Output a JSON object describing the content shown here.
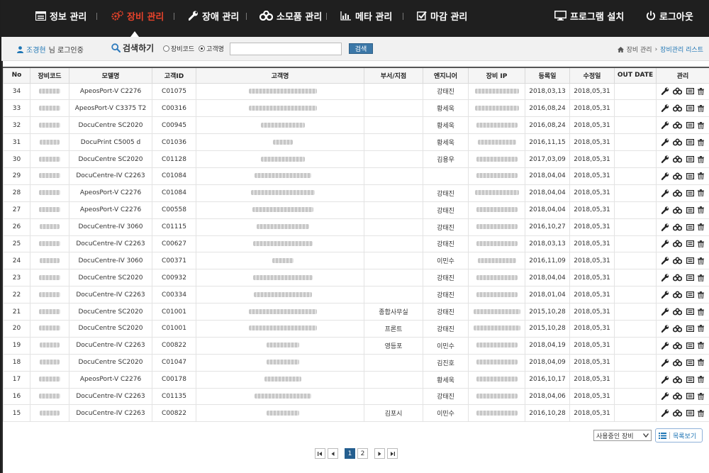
{
  "nav": {
    "items": [
      {
        "label": "정보 관리",
        "icon": "monitor-window-icon"
      },
      {
        "label": "장비 관리",
        "icon": "gears-icon",
        "active": true
      },
      {
        "label": "장애 관리",
        "icon": "wrench-icon"
      },
      {
        "label": "소모품 관리",
        "icon": "cogs-icon"
      },
      {
        "label": "메타 관리",
        "icon": "bar-chart-icon"
      },
      {
        "label": "마감 관리",
        "icon": "checkbox-icon"
      }
    ],
    "install_label": "프로그램 설치",
    "logout_label": "로그아웃"
  },
  "subbar": {
    "user_name": "조경현",
    "user_suffix": "님 로그인중",
    "search_title": "검색하기",
    "radio_equipment_code": "장비코드",
    "radio_customer_name": "고객명",
    "search_value": "",
    "search_button": "검색",
    "breadcrumb_home": "장비 관리",
    "breadcrumb_current": "장비관리 리스트"
  },
  "table": {
    "columns": [
      "No",
      "장비코드",
      "모델명",
      "고객ID",
      "고객명",
      "부서/지점",
      "엔지니어",
      "장비 IP",
      "등록일",
      "수정일",
      "OUT DATE",
      "관리"
    ],
    "rows": [
      {
        "no": "34",
        "model": "ApeosPort-V C2276",
        "cid": "C01075",
        "dept": "",
        "eng": "강태진",
        "reg": "2018,03,13",
        "mod": "2018,05,31",
        "out": ""
      },
      {
        "no": "33",
        "model": "ApeosPort-V C3375 T2",
        "cid": "C00316",
        "dept": "",
        "eng": "황세욱",
        "reg": "2016,08,24",
        "mod": "2018,05,31",
        "out": ""
      },
      {
        "no": "32",
        "model": "DocuCentre SC2020",
        "cid": "C00945",
        "dept": "",
        "eng": "황세욱",
        "reg": "2016,08,24",
        "mod": "2018,05,31",
        "out": ""
      },
      {
        "no": "31",
        "model": "DocuPrint C5005 d",
        "cid": "C01036",
        "dept": "",
        "eng": "황세욱",
        "reg": "2016,11,15",
        "mod": "2018,05,31",
        "out": ""
      },
      {
        "no": "30",
        "model": "DocuCentre SC2020",
        "cid": "C01128",
        "dept": "",
        "eng": "김용우",
        "reg": "2017,03,09",
        "mod": "2018,05,31",
        "out": ""
      },
      {
        "no": "29",
        "model": "DocuCentre-IV C2263",
        "cid": "C01084",
        "dept": "",
        "eng": "",
        "reg": "2018,04,04",
        "mod": "2018,05,31",
        "out": ""
      },
      {
        "no": "28",
        "model": "ApeosPort-V C2276",
        "cid": "C01084",
        "dept": "",
        "eng": "강태진",
        "reg": "2018,04,04",
        "mod": "2018,05,31",
        "out": ""
      },
      {
        "no": "27",
        "model": "ApeosPort-V C2276",
        "cid": "C00558",
        "dept": "",
        "eng": "강태진",
        "reg": "2018,04,04",
        "mod": "2018,05,31",
        "out": ""
      },
      {
        "no": "26",
        "model": "DocuCentre-IV 3060",
        "cid": "C01115",
        "dept": "",
        "eng": "강태진",
        "reg": "2016,10,27",
        "mod": "2018,05,31",
        "out": ""
      },
      {
        "no": "25",
        "model": "DocuCentre-IV C2263",
        "cid": "C00627",
        "dept": "",
        "eng": "강태진",
        "reg": "2018,03,13",
        "mod": "2018,05,31",
        "out": ""
      },
      {
        "no": "24",
        "model": "DocuCentre-IV 3060",
        "cid": "C00371",
        "dept": "",
        "eng": "이민수",
        "reg": "2016,11,09",
        "mod": "2018,05,31",
        "out": ""
      },
      {
        "no": "23",
        "model": "DocuCentre SC2020",
        "cid": "C00932",
        "dept": "",
        "eng": "강태진",
        "reg": "2018,04,04",
        "mod": "2018,05,31",
        "out": ""
      },
      {
        "no": "22",
        "model": "DocuCentre-IV C2263",
        "cid": "C00334",
        "dept": "",
        "eng": "강태진",
        "reg": "2018,01,04",
        "mod": "2018,05,31",
        "out": ""
      },
      {
        "no": "21",
        "model": "DocuCentre SC2020",
        "cid": "C01001",
        "dept": "종합사무실",
        "eng": "강태진",
        "reg": "2015,10,28",
        "mod": "2018,05,31",
        "out": ""
      },
      {
        "no": "20",
        "model": "DocuCentre SC2020",
        "cid": "C01001",
        "dept": "프론트",
        "eng": "강태진",
        "reg": "2015,10,28",
        "mod": "2018,05,31",
        "out": ""
      },
      {
        "no": "19",
        "model": "DocuCentre-IV C2263",
        "cid": "C00822",
        "dept": "영등포",
        "eng": "이민수",
        "reg": "2018,04,19",
        "mod": "2018,05,31",
        "out": ""
      },
      {
        "no": "18",
        "model": "DocuCentre SC2020",
        "cid": "C01047",
        "dept": "",
        "eng": "김진호",
        "reg": "2018,04,09",
        "mod": "2018,05,31",
        "out": ""
      },
      {
        "no": "17",
        "model": "ApeosPort-V C2276",
        "cid": "C00178",
        "dept": "",
        "eng": "황세욱",
        "reg": "2016,10,17",
        "mod": "2018,05,31",
        "out": ""
      },
      {
        "no": "16",
        "model": "DocuCentre-IV C2263",
        "cid": "C01135",
        "dept": "",
        "eng": "강태진",
        "reg": "2018,04,06",
        "mod": "2018,05,31",
        "out": ""
      },
      {
        "no": "15",
        "model": "DocuCentre-IV C2263",
        "cid": "C00822",
        "dept": "김포시",
        "eng": "이민수",
        "reg": "2016,10,28",
        "mod": "2018,05,31",
        "out": ""
      }
    ]
  },
  "footer": {
    "status_select_value": "사용중인 장비",
    "list_button": "목록보기",
    "pages": [
      "1",
      "2"
    ],
    "current_page": "1"
  },
  "colors": {
    "nav_bg": "#1f1f1f",
    "nav_active": "#e8432b",
    "accent": "#1f76b5",
    "page_active": "#245e8f"
  }
}
